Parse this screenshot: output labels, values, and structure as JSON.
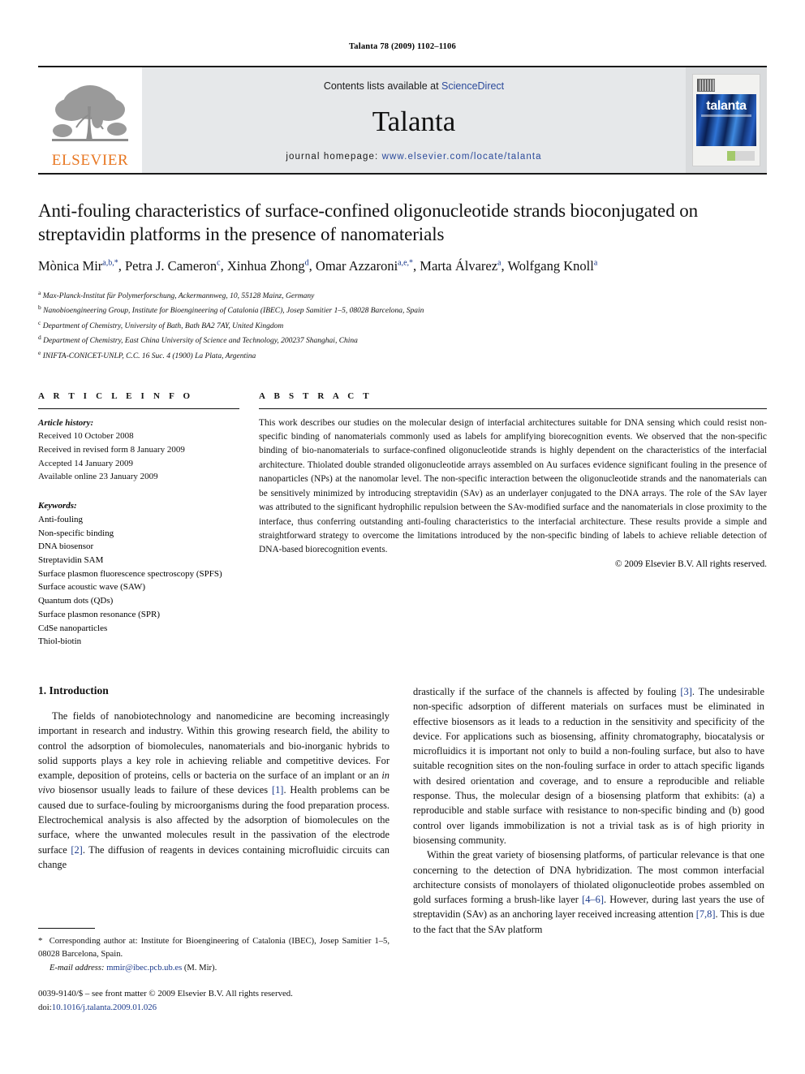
{
  "running_head": "Talanta 78 (2009) 1102–1106",
  "masthead": {
    "publisher_name": "ELSEVIER",
    "contents_prefix": "Contents lists available at ",
    "contents_link": "ScienceDirect",
    "journal_name": "Talanta",
    "homepage_prefix": "journal homepage:",
    "homepage_url": "www.elsevier.com/locate/talanta",
    "cover_title": "talanta",
    "link_color": "#2b4a9b",
    "brand_color": "#E87722"
  },
  "article": {
    "title": "Anti-fouling characteristics of surface-confined oligonucleotide strands bioconjugated on streptavidin platforms in the presence of nanomaterials",
    "authors_html": "Mònica Mir<sup>a,b,*</sup>, Petra J. Cameron<sup>c</sup>, Xinhua Zhong<sup>d</sup>, Omar Azzaroni<sup>a,e,*</sup>, Marta Álvarez<sup>a</sup>, Wolfgang Knoll<sup>a</sup>",
    "affiliations": [
      {
        "mark": "a",
        "text": "Max-Planck-Institut für Polymerforschung, Ackermannweg, 10, 55128 Mainz, Germany"
      },
      {
        "mark": "b",
        "text": "Nanobioengineering Group, Institute for Bioengineering of Catalonia (IBEC), Josep Samitier 1–5, 08028 Barcelona, Spain"
      },
      {
        "mark": "c",
        "text": "Department of Chemistry, University of Bath, Bath BA2 7AY, United Kingdom"
      },
      {
        "mark": "d",
        "text": "Department of Chemistry, East China University of Science and Technology, 200237 Shanghai, China"
      },
      {
        "mark": "e",
        "text": "INIFTA-CONICET-UNLP, C.C. 16 Suc. 4 (1900) La Plata, Argentina"
      }
    ]
  },
  "article_info": {
    "heading": "A R T I C L E   I N F O",
    "history_label": "Article history:",
    "history": [
      "Received 10 October 2008",
      "Received in revised form 8 January 2009",
      "Accepted 14 January 2009",
      "Available online 23 January 2009"
    ],
    "keywords_label": "Keywords:",
    "keywords": [
      "Anti-fouling",
      "Non-specific binding",
      "DNA biosensor",
      "Streptavidin SAM",
      "Surface plasmon fluorescence spectroscopy (SPFS)",
      "Surface acoustic wave (SAW)",
      "Quantum dots (QDs)",
      "Surface plasmon resonance (SPR)",
      "CdSe nanoparticles",
      "Thiol-biotin"
    ]
  },
  "abstract": {
    "heading": "A B S T R A C T",
    "text": "This work describes our studies on the molecular design of interfacial architectures suitable for DNA sensing which could resist non-specific binding of nanomaterials commonly used as labels for amplifying biorecognition events. We observed that the non-specific binding of bio-nanomaterials to surface-confined oligonucleotide strands is highly dependent on the characteristics of the interfacial architecture. Thiolated double stranded oligonucleotide arrays assembled on Au surfaces evidence significant fouling in the presence of nanoparticles (NPs) at the nanomolar level. The non-specific interaction between the oligonucleotide strands and the nanomaterials can be sensitively minimized by introducing streptavidin (SAv) as an underlayer conjugated to the DNA arrays. The role of the SAv layer was attributed to the significant hydrophilic repulsion between the SAv-modified surface and the nanomaterials in close proximity to the interface, thus conferring outstanding anti-fouling characteristics to the interfacial architecture. These results provide a simple and straightforward strategy to overcome the limitations introduced by the non-specific binding of labels to achieve reliable detection of DNA-based biorecognition events.",
    "copyright": "© 2009 Elsevier B.V. All rights reserved."
  },
  "body": {
    "section_number_title": "1.  Introduction",
    "left_paragraph_html": "The fields of nanobiotechnology and nanomedicine are becoming increasingly important in research and industry. Within this growing research field, the ability to control the adsorption of biomolecules, nanomaterials and bio-inorganic hybrids to solid supports plays a key role in achieving reliable and competitive devices. For example, deposition of proteins, cells or bacteria on the surface of an implant or an <span class=\"it\">in vivo</span> biosensor usually leads to failure of these devices <span class=\"ref\">[1]</span>. Health problems can be caused due to surface-fouling by microorganisms during the food preparation process. Electrochemical analysis is also affected by the adsorption of biomolecules on the surface, where the unwanted molecules result in the passivation of the electrode surface <span class=\"ref\">[2]</span>. The diffusion of reagents in devices containing microfluidic circuits can change",
    "right_paragraph1_html": "drastically if the surface of the channels is affected by fouling <span class=\"ref\">[3]</span>. The undesirable non-specific adsorption of different materials on surfaces must be eliminated in effective biosensors as it leads to a reduction in the sensitivity and specificity of the device. For applications such as biosensing, affinity chromatography, biocatalysis or microfluidics it is important not only to build a non-fouling surface, but also to have suitable recognition sites on the non-fouling surface in order to attach specific ligands with desired orientation and coverage, and to ensure a reproducible and reliable response. Thus, the molecular design of a biosensing platform that exhibits: (a) a reproducible and stable surface with resistance to non-specific binding and (b) good control over ligands immobilization is not a trivial task as is of high priority in biosensing community.",
    "right_paragraph2_html": "Within the great variety of biosensing platforms, of particular relevance is that one concerning to the detection of DNA hybridization. The most common interfacial architecture consists of monolayers of thiolated oligonucleotide probes assembled on gold surfaces forming a brush-like layer <span class=\"ref\">[4–6]</span>. However, during last years the use of streptavidin (SAv) as an anchoring layer received increasing attention <span class=\"ref\">[7,8]</span>. This is due to the fact that the SAv platform"
  },
  "footnotes": {
    "corresponding_html": "<span class=\"star\">*</span>&nbsp; Corresponding author at: Institute for Bioengineering of Catalonia (IBEC), Josep Samitier 1–5, 08028 Barcelona, Spain.",
    "email_label": "E-mail address:",
    "email_address": "mmir@ibec.pcb.ub.es",
    "email_owner": "(M. Mir)."
  },
  "footer": {
    "issn_line": "0039-9140/$ – see front matter © 2009 Elsevier B.V. All rights reserved.",
    "doi_label": "doi:",
    "doi_value": "10.1016/j.talanta.2009.01.026"
  }
}
